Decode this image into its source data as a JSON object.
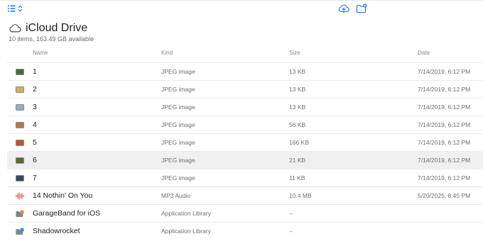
{
  "toolbar": {
    "view_icon": "list-view-icon",
    "sort_icon": "chevron-updown-icon",
    "upload_icon": "cloud-upload-icon",
    "new_folder_icon": "new-folder-icon",
    "accent_color": "#1a73e8"
  },
  "header": {
    "icon": "cloud-icon",
    "title": "iCloud Drive",
    "subtitle": "10 items, 163.49 GB available"
  },
  "columns": {
    "name": "Name",
    "kind": "Kind",
    "size": "Size",
    "date": "Date"
  },
  "files": [
    {
      "name": "1",
      "kind": "JPEG image",
      "size": "13 KB",
      "date": "7/14/2019, 6:12 PM",
      "icon": "image-thumbnail-icon",
      "thumb_color": "#4a6b3a"
    },
    {
      "name": "2",
      "kind": "JPEG image",
      "size": "13 KB",
      "date": "7/14/2019, 6:12 PM",
      "icon": "image-thumbnail-icon",
      "thumb_color": "#c9b25a"
    },
    {
      "name": "3",
      "kind": "JPEG image",
      "size": "13 KB",
      "date": "7/14/2019, 6:12 PM",
      "icon": "image-thumbnail-icon",
      "thumb_color": "#8fb0c9"
    },
    {
      "name": "4",
      "kind": "JPEG image",
      "size": "56 KB",
      "date": "7/14/2019, 6:12 PM",
      "icon": "image-thumbnail-icon",
      "thumb_color": "#b8794a"
    },
    {
      "name": "5",
      "kind": "JPEG image",
      "size": "166 KB",
      "date": "7/14/2019, 6:12 PM",
      "icon": "image-thumbnail-icon",
      "thumb_color": "#c0542f"
    },
    {
      "name": "6",
      "kind": "JPEG image",
      "size": "21 KB",
      "date": "7/14/2019, 6:12 PM",
      "icon": "image-thumbnail-icon",
      "thumb_color": "#5e6b2f"
    },
    {
      "name": "7",
      "kind": "JPEG image",
      "size": "11 KB",
      "date": "7/14/2019, 6:12 PM",
      "icon": "image-thumbnail-icon",
      "thumb_color": "#3d4a5c"
    },
    {
      "name": "14 Nothin' On You",
      "kind": "MP3 Audio",
      "size": "10.4 MB",
      "date": "5/20/2025, 8:45 PM",
      "icon": "audio-waveform-icon",
      "thumb_color": "#e0443e"
    },
    {
      "name": "GarageBand for iOS",
      "kind": "Application Library",
      "size": "--",
      "date": "",
      "icon": "app-folder-icon",
      "thumb_color": "#f08a24"
    },
    {
      "name": "Shadowrocket",
      "kind": "Application Library",
      "size": "--",
      "date": "",
      "icon": "app-folder-icon",
      "thumb_color": "#2f8fe6"
    }
  ]
}
